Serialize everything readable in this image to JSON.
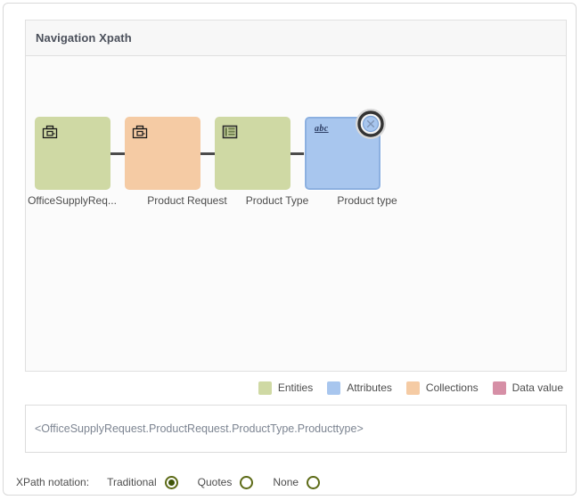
{
  "panel": {
    "title": "Navigation Xpath"
  },
  "diagram": {
    "nodes": [
      {
        "id": "node-1",
        "label": "OfficeSupplyReq...",
        "kind": "entity",
        "icon": "briefcase-icon",
        "color": "#cfd9a4",
        "selected": false
      },
      {
        "id": "node-2",
        "label": "Product Request",
        "kind": "collection",
        "icon": "briefcase-icon",
        "color": "#f5cba4",
        "selected": false
      },
      {
        "id": "node-3",
        "label": "Product Type",
        "kind": "entity",
        "icon": "table-icon",
        "color": "#cfd9a4",
        "selected": false
      },
      {
        "id": "node-4",
        "label": "Product type",
        "kind": "attribute",
        "icon": "abc-icon",
        "icon_text": "abc",
        "color": "#a8c6ee",
        "selected": true
      }
    ]
  },
  "legend": {
    "items": [
      {
        "label": "Entities",
        "color": "#cfd9a4"
      },
      {
        "label": "Attributes",
        "color": "#a8c6ee"
      },
      {
        "label": "Collections",
        "color": "#f5cba4"
      },
      {
        "label": "Data value",
        "color": "#d68fa6"
      }
    ]
  },
  "xpath": {
    "value": "<OfficeSupplyRequest.ProductRequest.ProductType.Producttype>"
  },
  "notation": {
    "label": "XPath notation:",
    "options": [
      {
        "label": "Traditional",
        "selected": true
      },
      {
        "label": "Quotes",
        "selected": false
      },
      {
        "label": "None",
        "selected": false
      }
    ],
    "accent": "#5d6b17"
  }
}
